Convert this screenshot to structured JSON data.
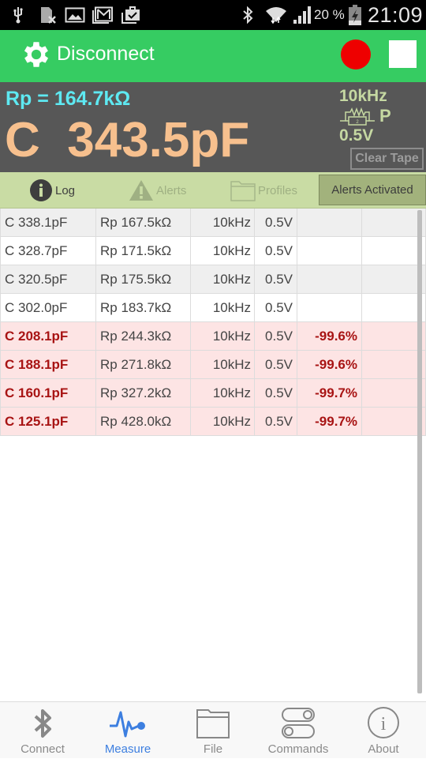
{
  "status_bar": {
    "icons": [
      "usb-icon",
      "no-sim-icon",
      "gallery-icon",
      "gmail-icon",
      "clipboard-check-icon",
      "bluetooth-icon",
      "wifi-icon",
      "signal-icon",
      "battery-charging-icon"
    ],
    "battery_percent": "20 %",
    "time": "21:09"
  },
  "action_bar": {
    "title": "Disconnect",
    "record_color": "#ee0000"
  },
  "readout": {
    "rp_line": "Rp = 164.7kΩ",
    "main_value": "C  343.5pF",
    "frequency": "10kHz",
    "mode": "P",
    "voltage": "0.5V",
    "clear_tape_label": "Clear Tape"
  },
  "tabs": {
    "log": "Log",
    "alerts": "Alerts",
    "profiles": "Profiles",
    "alerts_activated": "Alerts Activated"
  },
  "table": {
    "rows": [
      {
        "c": "C 338.1pF",
        "rp": "Rp 167.5kΩ",
        "freq": "10kHz",
        "volt": "0.5V",
        "delta": "",
        "alert": false
      },
      {
        "c": "C 328.7pF",
        "rp": "Rp 171.5kΩ",
        "freq": "10kHz",
        "volt": "0.5V",
        "delta": "",
        "alert": false
      },
      {
        "c": "C 320.5pF",
        "rp": "Rp 175.5kΩ",
        "freq": "10kHz",
        "volt": "0.5V",
        "delta": "",
        "alert": false
      },
      {
        "c": "C 302.0pF",
        "rp": "Rp 183.7kΩ",
        "freq": "10kHz",
        "volt": "0.5V",
        "delta": "",
        "alert": false
      },
      {
        "c": "C 208.1pF",
        "rp": "Rp 244.3kΩ",
        "freq": "10kHz",
        "volt": "0.5V",
        "delta": "-99.6%",
        "alert": true
      },
      {
        "c": "C 188.1pF",
        "rp": "Rp 271.8kΩ",
        "freq": "10kHz",
        "volt": "0.5V",
        "delta": "-99.6%",
        "alert": true
      },
      {
        "c": "C 160.1pF",
        "rp": "Rp 327.2kΩ",
        "freq": "10kHz",
        "volt": "0.5V",
        "delta": "-99.7%",
        "alert": true
      },
      {
        "c": "C 125.1pF",
        "rp": "Rp 428.0kΩ",
        "freq": "10kHz",
        "volt": "0.5V",
        "delta": "-99.7%",
        "alert": true
      }
    ]
  },
  "bottom_nav": {
    "items": [
      {
        "label": "Connect",
        "icon": "bluetooth-icon",
        "active": false
      },
      {
        "label": "Measure",
        "icon": "pulse-icon",
        "active": true
      },
      {
        "label": "File",
        "icon": "folder-icon",
        "active": false
      },
      {
        "label": "Commands",
        "icon": "toggles-icon",
        "active": false
      },
      {
        "label": "About",
        "icon": "info-icon",
        "active": false
      }
    ]
  },
  "colors": {
    "action_bar": "#36cc62",
    "readout_bg": "#575757",
    "rp_text": "#5ee9f2",
    "main_value": "#f7c08e",
    "settings_text": "#c5d8a2",
    "tabbar_bg": "#c9dca4",
    "alert_row_bg": "#fde4e4",
    "alert_text": "#a81414",
    "nav_active": "#3d7fe0"
  }
}
